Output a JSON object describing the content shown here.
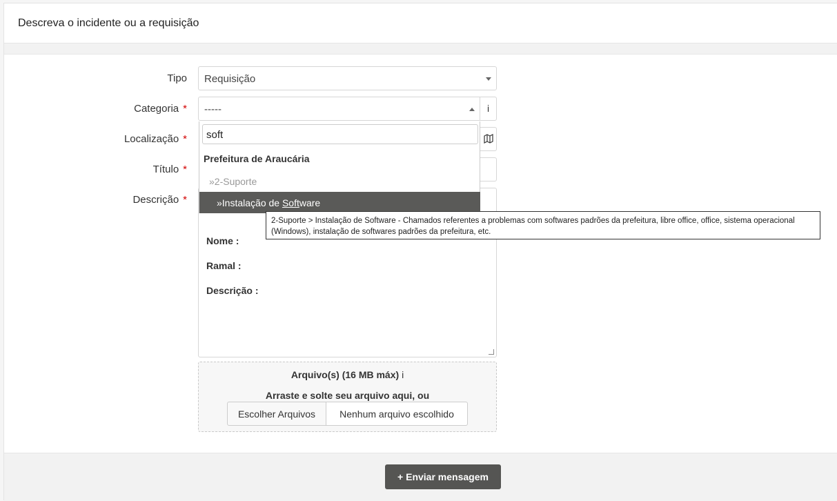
{
  "header": {
    "title": "Descreva o incidente ou a requisição"
  },
  "form": {
    "tipo": {
      "label": "Tipo",
      "value": "Requisição"
    },
    "categoria": {
      "label": "Categoria",
      "required": "*",
      "value": "-----",
      "info_icon": "i"
    },
    "localizacao": {
      "label": "Localização",
      "required": "*"
    },
    "titulo": {
      "label": "Título",
      "required": "*"
    },
    "descricao": {
      "label": "Descrição",
      "required": "*",
      "lines": [
        "Nome :",
        "Ramal :",
        "Descrição :"
      ]
    }
  },
  "dropdown": {
    "search_value": "soft",
    "group": "Prefeitura de Araucária",
    "subgroup": "»2-Suporte",
    "selected_prefix": "»Instalação de ",
    "selected_match": "Soft",
    "selected_suffix": "ware"
  },
  "tooltip": {
    "text": "2-Suporte > Instalação de Software - Chamados referentes a problemas com softwares padrões da prefeitura, libre office, office, sistema operacional (Windows), instalação de softwares padrões da prefeitura, etc."
  },
  "upload": {
    "title": "Arquivo(s) (16 MB máx)",
    "info_icon": "i",
    "drop_text": "Arraste e solte seu arquivo aqui, ou",
    "choose_button": "Escolher Arquivos",
    "no_file": "Nenhum arquivo escolhido"
  },
  "footer": {
    "submit_label": "Enviar mensagem",
    "submit_icon": "+"
  }
}
